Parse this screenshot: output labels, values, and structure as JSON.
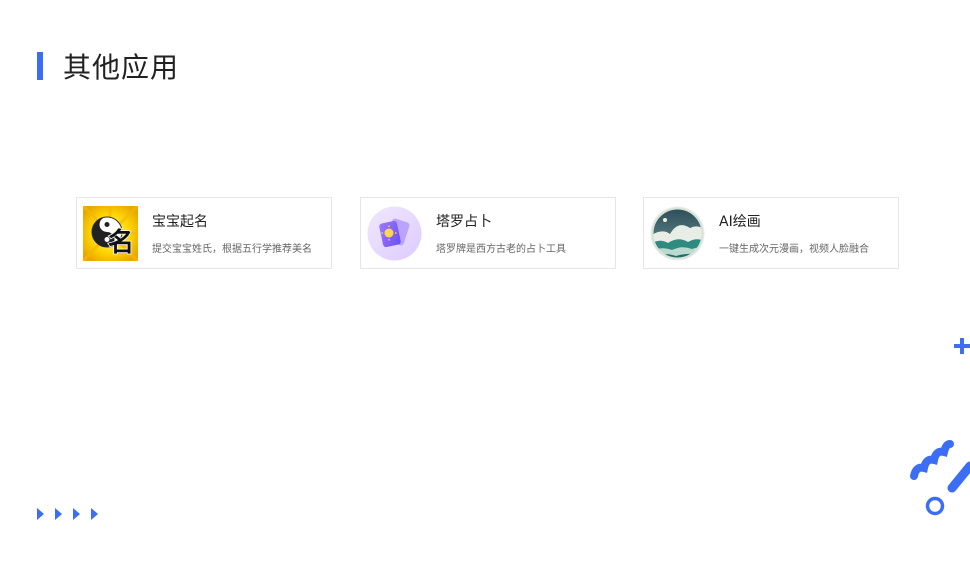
{
  "section": {
    "title": "其他应用"
  },
  "apps": [
    {
      "name": "宝宝起名",
      "desc": "提交宝宝姓氏，根据五行学推荐美名",
      "icon": "yin-yang-name-icon"
    },
    {
      "name": "塔罗占卜",
      "desc": "塔罗牌是西方古老的占卜工具",
      "icon": "tarot-cards-icon"
    },
    {
      "name": "AI绘画",
      "desc": "一键生成次元漫画，视频人脸融合",
      "icon": "ai-painting-wave-icon"
    }
  ],
  "colors": {
    "accent": "#3b6df5"
  },
  "decorations": [
    "plus-icon",
    "arrows-icon",
    "wavy-line-icon",
    "ring-icon"
  ],
  "icon_text": {
    "baby_name_glyph": "名"
  }
}
